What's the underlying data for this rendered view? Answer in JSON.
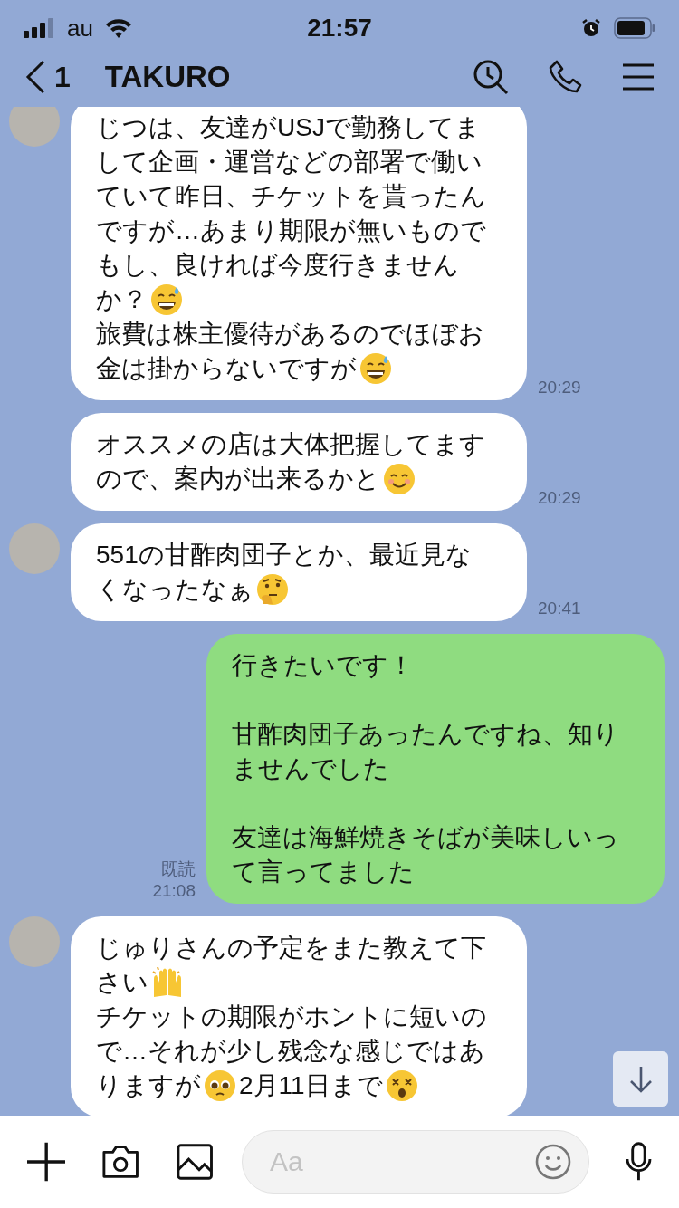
{
  "status_bar": {
    "carrier": "au",
    "time": "21:57"
  },
  "header": {
    "back_count": "1",
    "title": "TAKURO"
  },
  "messages": [
    {
      "sent": false,
      "avatar": true,
      "time": "20:29",
      "paragraphs": [
        {
          "lines": [
            {
              "parts": [
                {
                  "kind": "text",
                  "text": "じつは、友達がUSJで勤務してま"
                }
              ]
            },
            {
              "parts": [
                {
                  "kind": "text",
                  "text": "して企画・運営などの部署で働い"
                }
              ]
            },
            {
              "parts": [
                {
                  "kind": "text",
                  "text": "ていて昨日、チケットを貰ったん"
                }
              ]
            },
            {
              "parts": [
                {
                  "kind": "text",
                  "text": "ですが…あまり期限が無いもので"
                }
              ]
            },
            {
              "parts": [
                {
                  "kind": "text",
                  "text": "もし、良ければ今度行きません"
                }
              ]
            },
            {
              "parts": [
                {
                  "kind": "text",
                  "text": "か？"
                },
                {
                  "kind": "sweat-smile"
                }
              ]
            },
            {
              "parts": [
                {
                  "kind": "text",
                  "text": "旅費は株主優待があるのでほぼお"
                }
              ]
            },
            {
              "parts": [
                {
                  "kind": "text",
                  "text": "金は掛からないですが"
                },
                {
                  "kind": "sweat-smile"
                }
              ]
            }
          ]
        }
      ]
    },
    {
      "sent": false,
      "avatar": false,
      "time": "20:29",
      "paragraphs": [
        {
          "lines": [
            {
              "parts": [
                {
                  "kind": "text",
                  "text": "オススメの店は大体把握してます"
                }
              ]
            },
            {
              "parts": [
                {
                  "kind": "text",
                  "text": "ので、案内が出来るかと"
                },
                {
                  "kind": "smile"
                }
              ]
            }
          ]
        }
      ]
    },
    {
      "sent": false,
      "avatar": true,
      "time": "20:41",
      "paragraphs": [
        {
          "lines": [
            {
              "parts": [
                {
                  "kind": "text",
                  "text": "551の甘酢肉団子とか、最近見な"
                }
              ]
            },
            {
              "parts": [
                {
                  "kind": "text",
                  "text": "くなったなぁ"
                },
                {
                  "kind": "thinking"
                }
              ]
            }
          ]
        }
      ]
    },
    {
      "sent": true,
      "read": "既読",
      "time": "21:08",
      "paragraphs": [
        {
          "lines": [
            {
              "parts": [
                {
                  "kind": "text",
                  "text": "行きたいです！"
                }
              ]
            }
          ]
        },
        {
          "lines": [
            {
              "parts": [
                {
                  "kind": "text",
                  "text": "甘酢肉団子あったんですね、知り"
                }
              ]
            },
            {
              "parts": [
                {
                  "kind": "text",
                  "text": "ませんでした"
                }
              ]
            }
          ]
        },
        {
          "lines": [
            {
              "parts": [
                {
                  "kind": "text",
                  "text": "友達は海鮮焼きそばが美味しいっ"
                }
              ]
            },
            {
              "parts": [
                {
                  "kind": "text",
                  "text": "て言ってました"
                }
              ]
            }
          ]
        }
      ]
    },
    {
      "sent": false,
      "avatar": true,
      "paragraphs": [
        {
          "lines": [
            {
              "parts": [
                {
                  "kind": "text",
                  "text": "じゅりさんの予定をまた教えて下"
                }
              ]
            },
            {
              "parts": [
                {
                  "kind": "text",
                  "text": "さい"
                },
                {
                  "kind": "raised-hands"
                }
              ]
            },
            {
              "parts": [
                {
                  "kind": "text",
                  "text": "チケットの期限がホントに短いの"
                }
              ]
            },
            {
              "parts": [
                {
                  "kind": "text",
                  "text": "で…それが少し残念な感じではあ"
                }
              ]
            },
            {
              "parts": [
                {
                  "kind": "text",
                  "text": "りますが"
                },
                {
                  "kind": "pleading"
                },
                {
                  "kind": "text",
                  "text": "2月11日まで"
                },
                {
                  "kind": "dizzy"
                }
              ]
            }
          ]
        }
      ]
    }
  ],
  "composer": {
    "placeholder": "Aa"
  }
}
